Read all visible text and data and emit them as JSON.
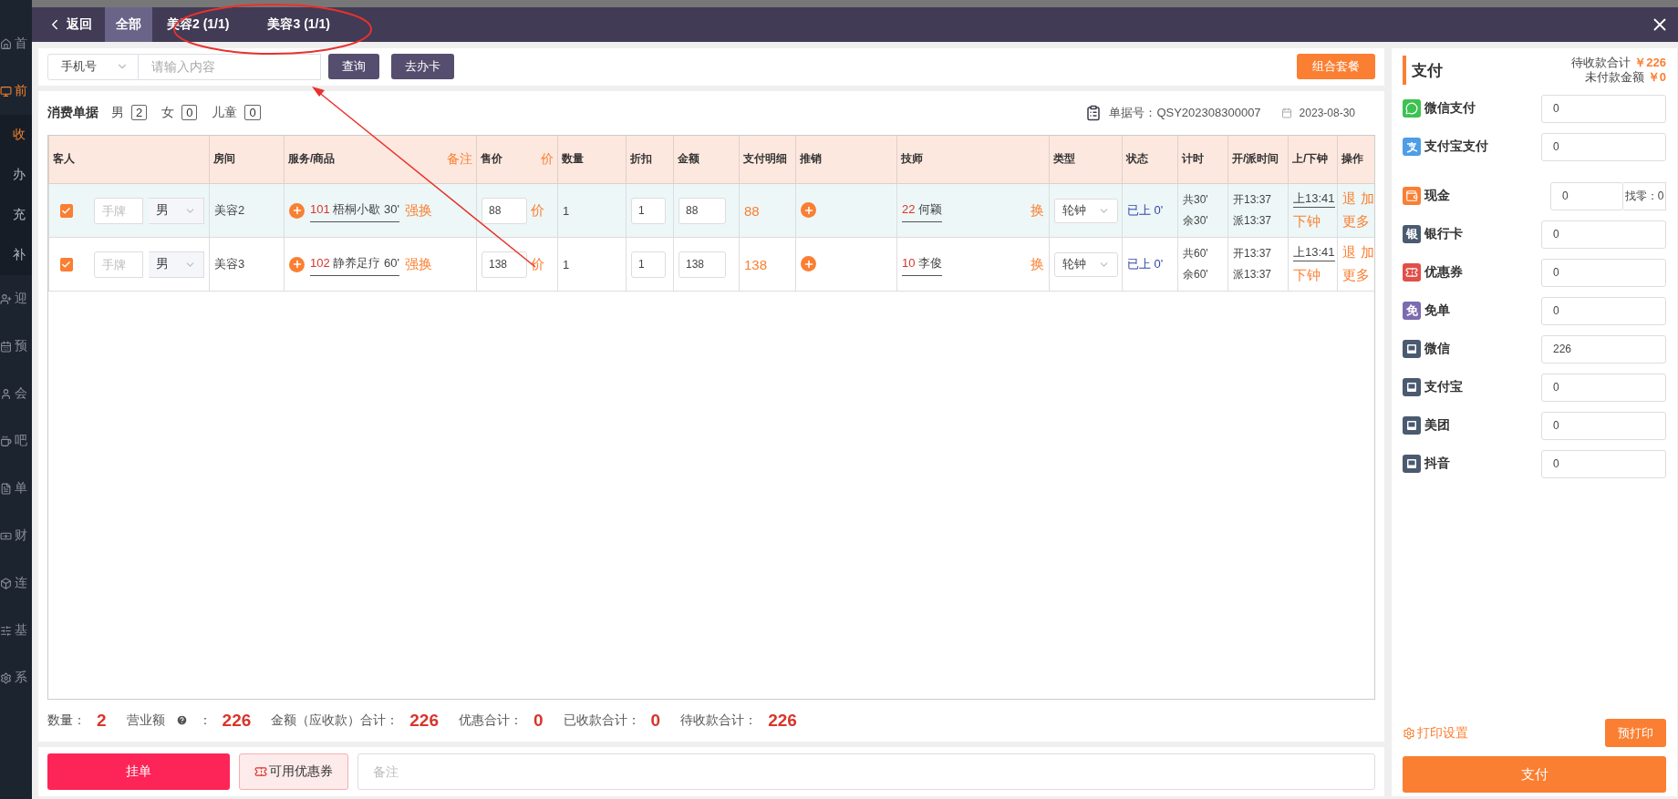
{
  "sidebar": {
    "items": [
      {
        "label": "首",
        "selected": false
      },
      {
        "label": "前",
        "selected": true,
        "children": [
          {
            "label": "收",
            "selected": true
          },
          {
            "label": "办",
            "selected": false
          },
          {
            "label": "充",
            "selected": false
          },
          {
            "label": "补",
            "selected": false
          }
        ]
      },
      {
        "label": "迎",
        "selected": false
      },
      {
        "label": "预",
        "selected": false
      },
      {
        "label": "会",
        "selected": false
      },
      {
        "label": "吧",
        "selected": false
      },
      {
        "label": "单",
        "selected": false
      },
      {
        "label": "财",
        "selected": false
      },
      {
        "label": "连",
        "selected": false
      },
      {
        "label": "基",
        "selected": false
      },
      {
        "label": "系",
        "selected": false
      }
    ]
  },
  "header": {
    "back": "返回",
    "tabs": [
      {
        "label": "全部",
        "selected": true
      },
      {
        "label": "美容2 (1/1)",
        "selected": false
      },
      {
        "label": "美容3 (1/1)",
        "selected": false
      }
    ]
  },
  "search": {
    "select": "手机号",
    "placeholder": "请输入内容",
    "buttons": [
      "查询",
      "去办卡"
    ],
    "package_button": "组合套餐"
  },
  "bill": {
    "title": "消费单据",
    "counts": [
      {
        "label": "男",
        "value": "2"
      },
      {
        "label": "女",
        "value": "0"
      },
      {
        "label": "儿童",
        "value": "0"
      }
    ],
    "number": "单据号：QSY202308300007",
    "date": "2023-08-30"
  },
  "table": {
    "columns": [
      {
        "label": "客人"
      },
      {
        "label": "房间"
      },
      {
        "label": "服务/商品",
        "extra": "备注"
      },
      {
        "label": "售价",
        "extra": "价"
      },
      {
        "label": "数量"
      },
      {
        "label": "折扣"
      },
      {
        "label": "金额"
      },
      {
        "label": "支付明细"
      },
      {
        "label": "推销"
      },
      {
        "label": "技师"
      },
      {
        "label": "类型"
      },
      {
        "label": "状态"
      },
      {
        "label": "计时"
      },
      {
        "label": "开/派时间"
      },
      {
        "label": "上/下钟"
      },
      {
        "label": "操作"
      }
    ],
    "rows": [
      {
        "checked": true,
        "selected": true,
        "hand_placeholder": "手牌",
        "gender": "男",
        "room": "美容2",
        "service_code": "101",
        "service_name": "梧桐小歇 30'",
        "swap": "强换",
        "price": "88",
        "price_tag": "价",
        "qty": "1",
        "discount": "1",
        "amount": "88",
        "pay_detail": "88",
        "tech_code": "22",
        "tech_name": "何颖",
        "tech_swap": "换",
        "type": "轮钟",
        "status": "已上 0'",
        "timing": [
          "共30'",
          "余30'"
        ],
        "times": [
          "开13:37",
          "派13:37"
        ],
        "clock_on": "上13:41",
        "clock_off": "下钟",
        "ops": [
          "退",
          "加",
          "更多"
        ]
      },
      {
        "checked": true,
        "selected": false,
        "hand_placeholder": "手牌",
        "gender": "男",
        "room": "美容3",
        "service_code": "102",
        "service_name": "静养足疗 60'",
        "swap": "强换",
        "price": "138",
        "price_tag": "价",
        "qty": "1",
        "discount": "1",
        "amount": "138",
        "pay_detail": "138",
        "tech_code": "10",
        "tech_name": "李俊",
        "tech_swap": "换",
        "type": "轮钟",
        "status": "已上 0'",
        "timing": [
          "共60'",
          "余60'"
        ],
        "times": [
          "开13:37",
          "派13:37"
        ],
        "clock_on": "上13:41",
        "clock_off": "下钟",
        "ops": [
          "退",
          "加",
          "更多"
        ]
      }
    ]
  },
  "totals": [
    {
      "label": "数量：",
      "value": "2",
      "help": false
    },
    {
      "label": "营业额",
      "colon": "：",
      "value": "226",
      "help": true
    },
    {
      "label": "金额（应收款）合计：",
      "value": "226",
      "help": false
    },
    {
      "label": "优惠合计：",
      "value": "0",
      "help": false
    },
    {
      "label": "已收款合计：",
      "value": "0",
      "help": false
    },
    {
      "label": "待收款合计：",
      "value": "226",
      "help": false
    }
  ],
  "actions": {
    "hold": "挂单",
    "coupons": "可用优惠券",
    "remark_placeholder": "备注"
  },
  "payment": {
    "title": "支付",
    "due_label": "待收款合计",
    "due": "￥226",
    "unpaid_label": "未付款金额",
    "unpaid": "￥0",
    "methods": [
      {
        "kind": "wechat",
        "label": "微信支付",
        "value": "0"
      },
      {
        "kind": "alipay",
        "label": "支付宝支付",
        "value": "0"
      },
      {
        "kind": "cash",
        "label": "现金",
        "value": "0",
        "change": "找零：0"
      },
      {
        "kind": "bank",
        "badge": "银",
        "label": "银行卡",
        "value": "0"
      },
      {
        "kind": "coupon",
        "label": "优惠券",
        "value": "0"
      },
      {
        "kind": "free",
        "badge": "免",
        "label": "免单",
        "value": "0"
      },
      {
        "kind": "generic",
        "label": "微信",
        "value": "226"
      },
      {
        "kind": "generic",
        "label": "支付宝",
        "value": "0"
      },
      {
        "kind": "generic",
        "label": "美团",
        "value": "0"
      },
      {
        "kind": "generic",
        "label": "抖音",
        "value": "0"
      }
    ],
    "print_settings": "打印设置",
    "preprint": "预打印",
    "pay": "支付"
  }
}
